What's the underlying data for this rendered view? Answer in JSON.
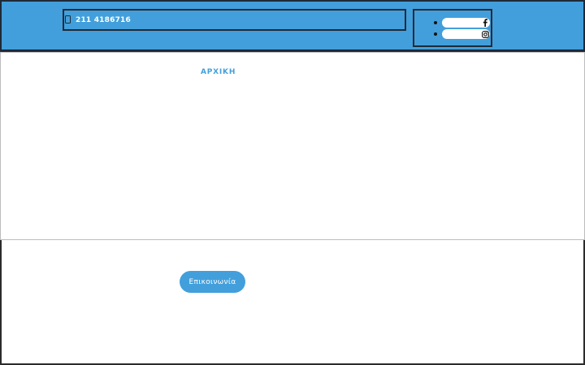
{
  "top_bar": {
    "background_color": "#429fdb",
    "border_color": "#1f2a38",
    "phone": {
      "icon": "phone-icon",
      "number": "211 4186716"
    },
    "social_links": [
      {
        "icon": "facebook-icon",
        "label": ""
      },
      {
        "icon": "instagram-icon",
        "label": ""
      }
    ]
  },
  "nav": {
    "home_label": "ΑΡΧΙΚΗ",
    "link_color": "#429fdb"
  },
  "cta": {
    "contact_label": "Επικοινωνία",
    "button_color": "#429fdb"
  }
}
